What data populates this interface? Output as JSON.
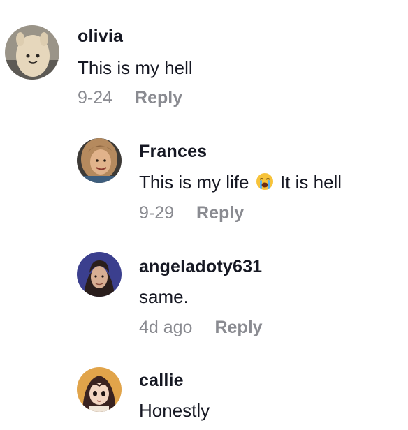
{
  "comments": [
    {
      "username": "olivia",
      "text": "This is my hell",
      "date": "9-24",
      "reply_label": "Reply",
      "avatar_icon": "plush-toy-avatar"
    },
    {
      "username": "Frances",
      "text_before": "This is my life",
      "emoji": "loudly-crying-face-emoji",
      "text_after": "It is hell",
      "date": "9-29",
      "reply_label": "Reply",
      "avatar_icon": "woman-photo-avatar"
    },
    {
      "username": "angeladoty631",
      "text": "same.",
      "date": "4d ago",
      "reply_label": "Reply",
      "avatar_icon": "man-photo-avatar"
    },
    {
      "username": "callie",
      "text": "Honestly",
      "avatar_icon": "anime-character-avatar"
    }
  ],
  "colors": {
    "username": "#161823",
    "text": "#161823",
    "meta": "#8a8b91"
  }
}
